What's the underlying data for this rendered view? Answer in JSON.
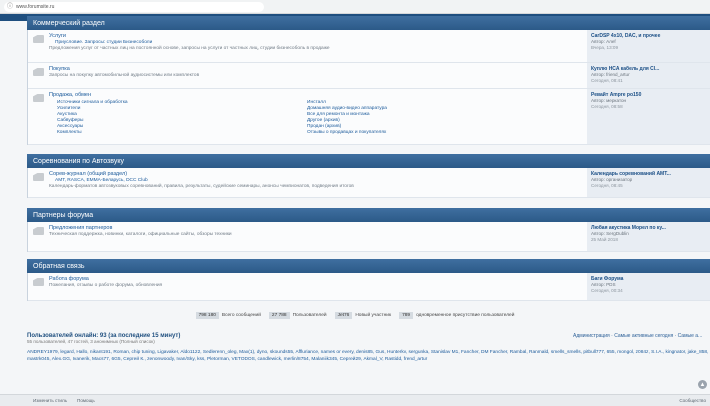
{
  "browser": {
    "url": "www.forumsite.ru"
  },
  "sections": [
    {
      "title": "Коммерческий раздел",
      "forums": [
        {
          "title": "Услуги",
          "subline": "Приусловие. Запросы: студии Бизнесоболи",
          "desc": "Предложения услуг от частных лиц на постоянной основе, запросы на услуги от частных лиц, студии бизнесоболь в продаже",
          "last_title": "CarDSP 4x10, DAC, и прочее",
          "last_author": "Автор: Алеf",
          "last_date": "Вчера, 13:09"
        },
        {
          "title": "Покупка",
          "desc": "Запросы на покупку автомобильной аудиосистемы или комплектов",
          "last_title": "Куплю HCA кабель для Cl...",
          "last_author": "Автор: friend_artur",
          "last_date": "Сегодня, 08:41"
        },
        {
          "title": "Продажа, обмен",
          "subs_left": [
            "Источники сигнала и обработка",
            "Усилители",
            "Акустика",
            "Сабвуферы",
            "Аксессуары",
            "Комплекты"
          ],
          "subs_right": [
            "Инсталл",
            "Домашняя аудио-видео аппаратура",
            "Все для ремонта и монтажа",
            "Другое (архив)",
            "Продан (архив)",
            "Отзывы о продавцах и покупателях"
          ],
          "last_title": "Ревайт Ampre po150",
          "last_author": "Автор: меркатон",
          "last_date": "Сегодня, 08:58"
        }
      ]
    },
    {
      "title": "Соревнования по Автозвуку",
      "forums": [
        {
          "title": "Сорев-журнал (общий раздел)",
          "subline": "AMT, RASCA, EMMA-Беларусь, DCC Club",
          "desc": "Календарь-форматов автозвуковых соревнований, правила, результаты, судейские семинары, анонсы чемпионатов, подведения итогов",
          "last_title": "Календарь соревнований AMT...",
          "last_author": "Автор: организатор",
          "last_date": "Сегодня, 08:45"
        }
      ]
    },
    {
      "title": "Партнеры форума",
      "forums": [
        {
          "title": "Предложения партнеров",
          "desc": "Техническая поддержка, новинки, каталоги, официальные сайты, обзоры техники",
          "last_title": "Любая акустика Морел по ку...",
          "last_author": "Автор: SergDublin",
          "last_date": "25 Май 2018"
        }
      ]
    },
    {
      "title": "Обратная связь",
      "forums": [
        {
          "title": "Работа форума",
          "desc": "Пожелания, отзывы о работе форума, обновления",
          "last_title": "Баги Форума",
          "last_author": "Автор: PDS",
          "last_date": "Сегодня, 00:34"
        }
      ]
    }
  ],
  "stats": [
    {
      "num": "798 180",
      "label": "Всего сообщений"
    },
    {
      "num": "27 788",
      "label": "Пользователей"
    },
    {
      "num": "Jet76",
      "label": "Новый участник"
    },
    {
      "num": "789",
      "label": "одновременное присутствие пользователей"
    }
  ],
  "online": {
    "heading": "Пользователей онлайн: 93 (за последние 15 минут)",
    "sub": "55 пользователей, 47 гостей, 3 анонимных  (Полный список)",
    "links": "Администрация · Самые активные сегодня · Самые а...",
    "users": "ANDREY1979, legard, Hallo, nikant191, Roman, chip tuning, Ligavaker, Aldo1122, Sedlerenn_oleg, Max(1), dyno, skounds55, Affluriance, names or every, denis85, Gus, Hunterkv, sergunka, Stanislav M1, Fancher, DM Fancher, Rambal, Ranmald, smells_smells, pitbull777, 655, mongol, z084z, S.I.A., kingnator, jake_858, mastrk045, Alex.GG, Ivanerik, Macs77, 6G5, Сергей К., zenonwoody, Ivan/Sky, kss, Pletorman, VETODOS, candlewick, merlin/8754, Malaniik345, Сергей29, Akmal_V, Rastidd, frend_artur"
  },
  "footer": {
    "left1": "Изменить стиль",
    "left2": "Помощь",
    "right": "Сообщество"
  }
}
